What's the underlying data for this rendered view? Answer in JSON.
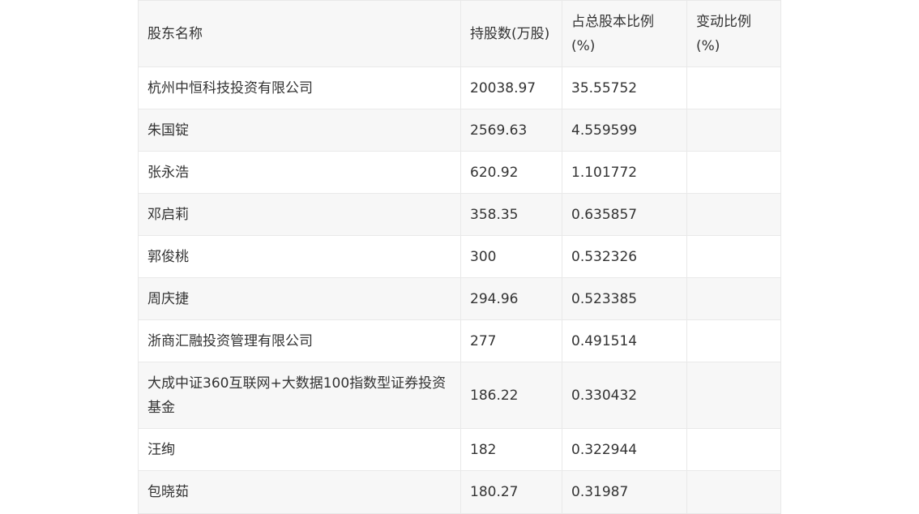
{
  "table": {
    "headers": [
      "股东名称",
      "持股数(万股)",
      "占总股本比例(%)",
      "变动比例(%)"
    ],
    "rows": [
      {
        "name": "杭州中恒科技投资有限公司",
        "shares": "20038.97",
        "ratio": "35.55752",
        "change": ""
      },
      {
        "name": "朱国锭",
        "shares": "2569.63",
        "ratio": "4.559599",
        "change": ""
      },
      {
        "name": "张永浩",
        "shares": "620.92",
        "ratio": "1.101772",
        "change": ""
      },
      {
        "name": "邓启莉",
        "shares": "358.35",
        "ratio": "0.635857",
        "change": ""
      },
      {
        "name": "郭俊桃",
        "shares": "300",
        "ratio": "0.532326",
        "change": ""
      },
      {
        "name": "周庆捷",
        "shares": "294.96",
        "ratio": "0.523385",
        "change": ""
      },
      {
        "name": "浙商汇融投资管理有限公司",
        "shares": "277",
        "ratio": "0.491514",
        "change": ""
      },
      {
        "name": "大成中证360互联网+大数据100指数型证券投资基金",
        "shares": "186.22",
        "ratio": "0.330432",
        "change": ""
      },
      {
        "name": "汪绚",
        "shares": "182",
        "ratio": "0.322944",
        "change": ""
      },
      {
        "name": "包晓茹",
        "shares": "180.27",
        "ratio": "0.31987",
        "change": ""
      }
    ]
  }
}
